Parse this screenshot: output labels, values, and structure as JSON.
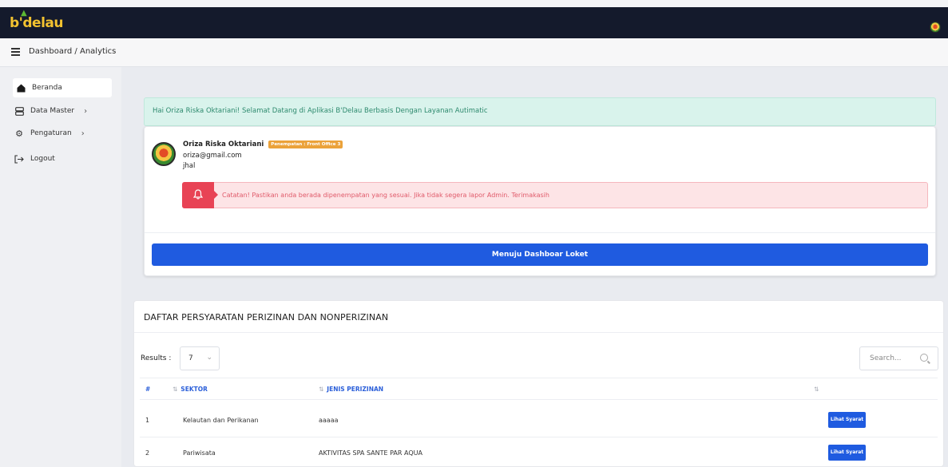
{
  "app": {
    "logo_text": "b'delau",
    "breadcrumb": "Dashboard / Analytics"
  },
  "sidebar": {
    "items": [
      {
        "label": "Beranda",
        "icon": "home-icon"
      },
      {
        "label": "Data Master",
        "icon": "database-icon"
      },
      {
        "label": "Pengaturan",
        "icon": "gear-icon"
      },
      {
        "label": "Logout",
        "icon": "logout-icon"
      }
    ]
  },
  "welcome": {
    "greeting": "Hai Oriza Riska Oktariani! Selamat Datang di Aplikasi B'Delau Berbasis Dengan Layanan Autimatic"
  },
  "profile": {
    "name": "Oriza Riska Oktariani",
    "badge": "Penempatan : Front Office 3",
    "email": "oriza@gmail.com",
    "note": "jhal"
  },
  "alert": {
    "text": "Catatan! Pastikan anda berada dipenempatan yang sesuai. Jika tidak segera lapor Admin. Terimakasih"
  },
  "dashboard_button": "Menuju Dashboar Loket",
  "list": {
    "title": "DAFTAR PERSYARATAN PERIZINAN DAN NONPERIZINAN",
    "results_label": "Results :",
    "results_value": "7",
    "search_placeholder": "Search...",
    "columns": [
      "#",
      "SEKTOR",
      "JENIS PERIZINAN"
    ],
    "rows": [
      {
        "no": "1",
        "sektor": "Kelautan dan Perikanan",
        "jenis": "aaaaa",
        "action": "Lihat Syarat"
      },
      {
        "no": "2",
        "sektor": "Pariwisata",
        "jenis": "AKTIVITAS SPA SANTE PAR AQUA",
        "action": "Lihat Syarat"
      }
    ]
  },
  "colors": {
    "topbar": "#141a2c",
    "primary": "#1f5be0",
    "success_bg": "#d9f3ec",
    "danger": "#e84355",
    "warning": "#eba23a"
  }
}
